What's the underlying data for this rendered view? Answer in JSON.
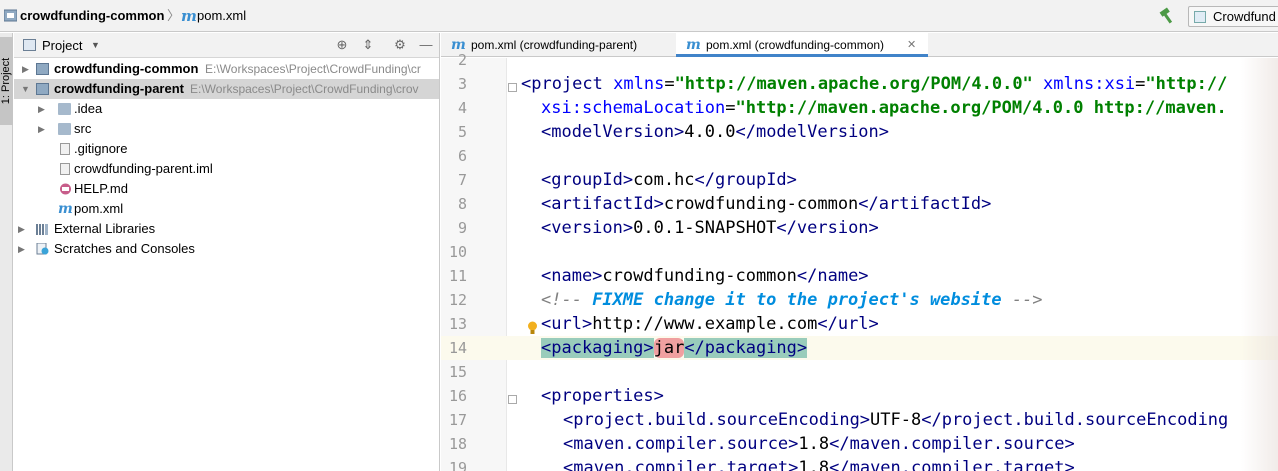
{
  "navbar": {
    "project": "crowdfunding-common",
    "separator": "〉",
    "file_icon": "m",
    "file": "pom.xml",
    "run_config": "Crowdfund"
  },
  "tool_strip": {
    "project_tab": "1: Project"
  },
  "project_panel": {
    "title": "Project",
    "dropdown": "▼",
    "buttons": {
      "locate": "⊕",
      "collapse": "⇕",
      "settings": "⚙",
      "hide": "—"
    },
    "tree": [
      {
        "label": "crowdfunding-common",
        "path": "E:\\Workspaces\\Project\\CrowdFunding\\cr",
        "bold": true
      },
      {
        "label": "crowdfunding-parent",
        "path": "E:\\Workspaces\\Project\\CrowdFunding\\crov",
        "bold": true
      },
      {
        "label": ".idea"
      },
      {
        "label": "src"
      },
      {
        "label": ".gitignore"
      },
      {
        "label": "crowdfunding-parent.iml"
      },
      {
        "label": "HELP.md"
      },
      {
        "label": "pom.xml"
      },
      {
        "label": "External Libraries"
      },
      {
        "label": "Scratches and Consoles"
      }
    ]
  },
  "editor": {
    "tabs": [
      {
        "icon": "m",
        "label": "pom.xml (crowdfunding-parent)",
        "close": "✕"
      },
      {
        "icon": "m",
        "label": "pom.xml (crowdfunding-common)",
        "close": "✕"
      }
    ],
    "line_numbers": [
      "2",
      "3",
      "4",
      "5",
      "6",
      "7",
      "8",
      "9",
      "10",
      "11",
      "12",
      "13",
      "14",
      "15",
      "16",
      "17",
      "18",
      "19"
    ],
    "code": {
      "l3": {
        "open": "<project ",
        "a1": "xmlns",
        "eq1": "=",
        "v1": "\"http://maven.apache.org/POM/4.0.0\"",
        "sp": " ",
        "a2": "xmlns:xsi",
        "eq2": "=",
        "v2": "\"http://"
      },
      "l4": {
        "a": "xsi:schemaLocation",
        "eq": "=",
        "v": "\"http://maven.apache.org/POM/4.0.0 http://maven."
      },
      "l4b": {
        "o": "<modelVersion>",
        "t": "4.0.0",
        "c": "</modelVersion>"
      },
      "l7": {
        "o": "<groupId>",
        "t": "com.hc",
        "c": "</groupId>"
      },
      "l8": {
        "o": "<artifactId>",
        "t": "crowdfunding-common",
        "c": "</artifactId>"
      },
      "l9": {
        "o": "<version>",
        "t": "0.0.1-SNAPSHOT",
        "c": "</version>"
      },
      "l11": {
        "o": "<name>",
        "t": "crowdfunding-common",
        "c": "</name>"
      },
      "l12": {
        "o": "<!-- ",
        "todo": "FIXME change it to the project's website",
        "c": " -->"
      },
      "l13": {
        "o": "<url>",
        "t": "http://www.example.com",
        "c": "</url>"
      },
      "l14": {
        "o": "<packaging>",
        "t": "jar",
        "c": "</packaging>"
      },
      "l16": {
        "o": "<properties>"
      },
      "l17": {
        "o": "<project.build.sourceEncoding>",
        "t": "UTF-8",
        "c": "</project.build.sourceEncoding"
      },
      "l18": {
        "o": "<maven.compiler.source>",
        "t": "1.8",
        "c": "</maven.compiler.source>"
      },
      "l19": {
        "o": "<maven.compiler.target>",
        "t": "1.8",
        "c": "</maven.compiler.target>"
      }
    }
  },
  "icons": {
    "hammer": "hammer-icon",
    "bulb": "lightbulb-icon"
  },
  "colors": {
    "tag": "#000080",
    "attr": "#0000ff",
    "attr_value": "#008000",
    "comment": "#808080",
    "todo": "#008dde",
    "tag_highlight": "#99ccbb",
    "current_line": "#fcfaed"
  }
}
